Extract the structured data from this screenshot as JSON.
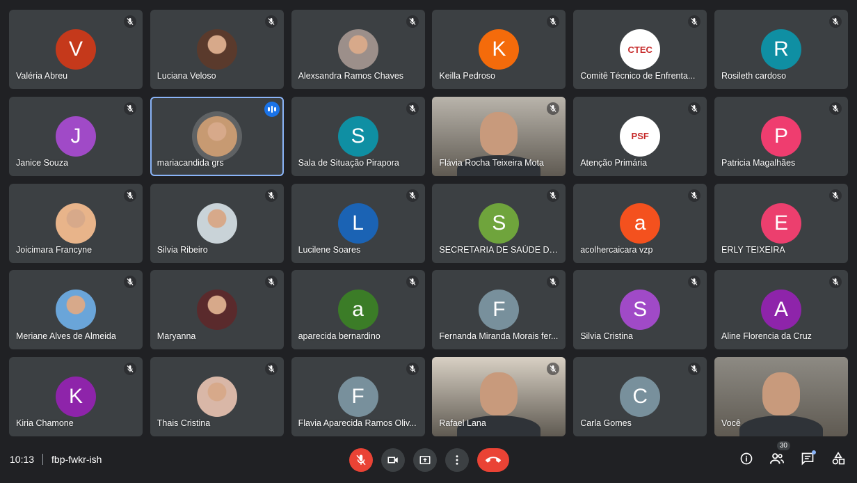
{
  "participants": [
    {
      "name": "Valéria Abreu",
      "initial": "V",
      "color": "#c5391b",
      "kind": "initial"
    },
    {
      "name": "Luciana Veloso",
      "kind": "photo",
      "color": "#5a3a2c"
    },
    {
      "name": "Alexsandra Ramos Chaves",
      "kind": "photo",
      "color": "#9c8f8a"
    },
    {
      "name": "Keilla Pedroso",
      "initial": "K",
      "color": "#f46b0b",
      "kind": "initial"
    },
    {
      "name": "Comitê Técnico de Enfrenta...",
      "kind": "logo",
      "color": "#ffffff",
      "logo_text": "CTEC"
    },
    {
      "name": "Rosileth cardoso",
      "initial": "R",
      "color": "#0f8fa3",
      "kind": "initial"
    },
    {
      "name": "Janice Souza",
      "initial": "J",
      "color": "#a04ac7",
      "kind": "initial"
    },
    {
      "name": "mariacandida grs",
      "kind": "photo",
      "color": "#c79a72",
      "active": true
    },
    {
      "name": "Sala de Situação Pirapora",
      "initial": "S",
      "color": "#0f8fa3",
      "kind": "initial"
    },
    {
      "name": "Flávia Rocha Teixeira Mota",
      "kind": "video",
      "color": "#b9b4ab"
    },
    {
      "name": "Atenção Primária",
      "kind": "logo",
      "color": "#ffffff",
      "logo_text": "PSF"
    },
    {
      "name": "Patricia Magalhães",
      "initial": "P",
      "color": "#ef3d6f",
      "kind": "initial"
    },
    {
      "name": "Joicimara Francyne",
      "kind": "photo",
      "color": "#e8b48a"
    },
    {
      "name": "Silvia Ribeiro",
      "kind": "photo",
      "color": "#c9d3d8"
    },
    {
      "name": "Lucilene Soares",
      "initial": "L",
      "color": "#1b63b4",
      "kind": "initial"
    },
    {
      "name": "SECRETARIA DE SAÚDE DE IB...",
      "initial": "S",
      "color": "#6fa43c",
      "kind": "initial"
    },
    {
      "name": "acolhercaicara vzp",
      "initial": "a",
      "color": "#f4511e",
      "kind": "initial"
    },
    {
      "name": "ERLY TEIXEIRA",
      "initial": "E",
      "color": "#ec3f6e",
      "kind": "initial"
    },
    {
      "name": "Meriane Alves de Almeida",
      "kind": "photo",
      "color": "#6aa5d9"
    },
    {
      "name": "Maryanna",
      "kind": "photo",
      "color": "#5a2a2c"
    },
    {
      "name": "aparecida bernardino",
      "initial": "a",
      "color": "#3b7c27",
      "kind": "initial"
    },
    {
      "name": "Fernanda Miranda Morais fer...",
      "initial": "F",
      "color": "#78909c",
      "kind": "initial"
    },
    {
      "name": "Silvia Cristina",
      "initial": "S",
      "color": "#a04ac7",
      "kind": "initial"
    },
    {
      "name": "Aline Florencia da Cruz",
      "initial": "A",
      "color": "#8e24aa",
      "kind": "initial"
    },
    {
      "name": "Kiria Chamone",
      "initial": "K",
      "color": "#8e24aa",
      "kind": "initial"
    },
    {
      "name": "Thais Cristina",
      "kind": "photo",
      "color": "#d9b7a7"
    },
    {
      "name": "Flavia Aparecida Ramos Oliv...",
      "initial": "F",
      "color": "#78909c",
      "kind": "initial"
    },
    {
      "name": "Rafael Lana",
      "kind": "video",
      "color": "#d8d0c4"
    },
    {
      "name": "Carla Gomes",
      "initial": "C",
      "color": "#78909c",
      "kind": "initial"
    },
    {
      "name": "Você",
      "kind": "video",
      "color": "#8d8a83",
      "self": true
    }
  ],
  "meeting": {
    "time": "10:13",
    "code": "fbp-fwkr-ish"
  },
  "people_count": "30",
  "icons": {
    "mic_off": "mic-off-icon",
    "camera": "camera-icon",
    "present": "present-screen-icon",
    "more": "more-options-icon",
    "hangup": "hang-up-icon",
    "info": "info-icon",
    "people": "people-icon",
    "chat": "chat-icon",
    "activities": "activities-icon"
  }
}
